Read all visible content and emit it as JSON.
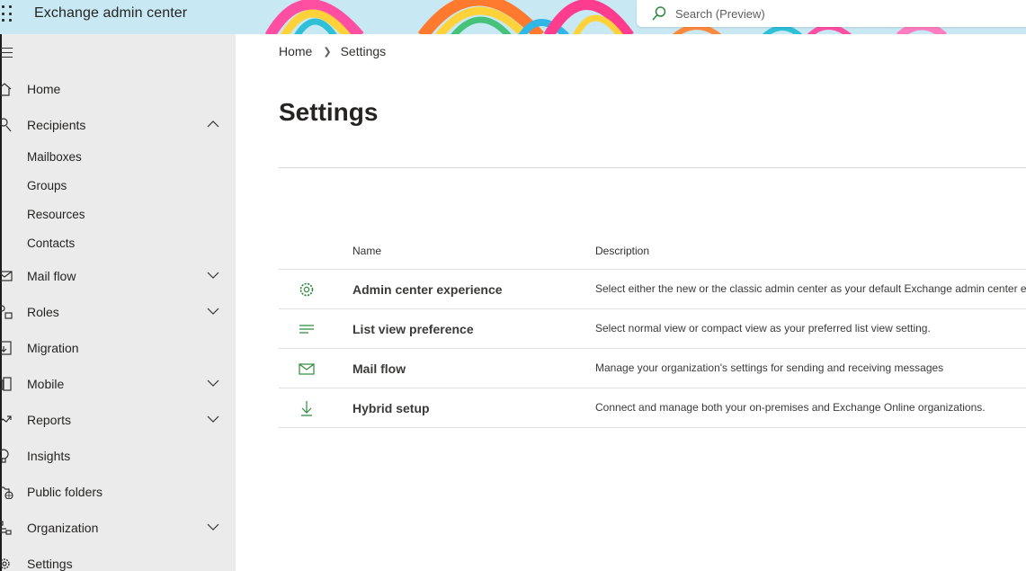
{
  "header": {
    "app_title": "Exchange admin center",
    "search_placeholder": "Search (Preview)",
    "icons": {
      "launcher": "waffle-icon",
      "search": "search-icon"
    }
  },
  "sidebar": {
    "menu_icon": "hamburger-icon",
    "items": [
      {
        "label": "Home",
        "icon": "home-icon",
        "chevron": "none"
      },
      {
        "label": "Recipients",
        "icon": "person-icon",
        "chevron": "up"
      },
      {
        "label": "Mail flow",
        "icon": "mail-icon",
        "chevron": "down"
      },
      {
        "label": "Roles",
        "icon": "roles-icon",
        "chevron": "down"
      },
      {
        "label": "Migration",
        "icon": "migration-icon",
        "chevron": "none"
      },
      {
        "label": "Mobile",
        "icon": "mobile-icon",
        "chevron": "down"
      },
      {
        "label": "Reports",
        "icon": "chart-icon",
        "chevron": "down"
      },
      {
        "label": "Insights",
        "icon": "lightbulb-icon",
        "chevron": "none"
      },
      {
        "label": "Public folders",
        "icon": "public-folder-icon",
        "chevron": "none"
      },
      {
        "label": "Organization",
        "icon": "organization-icon",
        "chevron": "down"
      },
      {
        "label": "Settings",
        "icon": "gear-icon",
        "chevron": "none"
      }
    ],
    "recipients_subitems": [
      "Mailboxes",
      "Groups",
      "Resources",
      "Contacts"
    ]
  },
  "main": {
    "breadcrumb": [
      "Home",
      "Settings"
    ],
    "title": "Settings",
    "table": {
      "columns": [
        "Name",
        "Description"
      ],
      "rows": [
        {
          "icon": "gear-icon",
          "name": "Admin center experience",
          "description": "Select either the new or the classic admin center as your default Exchange admin center experience."
        },
        {
          "icon": "list-icon",
          "name": "List view preference",
          "description": "Select normal view or compact view as your preferred list view setting."
        },
        {
          "icon": "mail-icon",
          "name": "Mail flow",
          "description": "Manage your organization's settings for sending and receiving messages"
        },
        {
          "icon": "download-icon",
          "name": "Hybrid setup",
          "description": "Connect and manage both your on-premises and Exchange Online organizations."
        }
      ]
    }
  },
  "colors": {
    "header_bg": "#c8e8f4",
    "sidebar_bg": "#ebebeb",
    "accent_green": "#2f8a3b",
    "text": "#252423"
  }
}
